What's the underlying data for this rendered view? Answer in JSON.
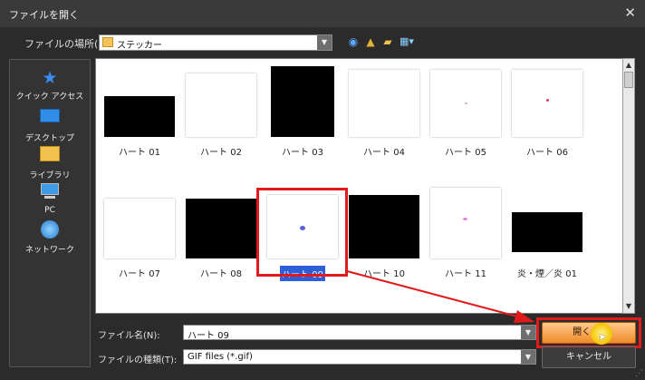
{
  "dialog": {
    "title": "ファイルを開く",
    "close_icon": "✕"
  },
  "lookin": {
    "label": "ファイルの場所(I):",
    "value": "ステッカー"
  },
  "places": [
    {
      "name": "クイック アクセス",
      "icon": "star-icon"
    },
    {
      "name": "デスクトップ",
      "icon": "desktop-icon"
    },
    {
      "name": "ライブラリ",
      "icon": "library-icon"
    },
    {
      "name": "PC",
      "icon": "computer-icon"
    },
    {
      "name": "ネットワーク",
      "icon": "network-icon"
    }
  ],
  "files": [
    {
      "name": "ハート 01",
      "thumb": "black-wide"
    },
    {
      "name": "ハート 02",
      "thumb": "white"
    },
    {
      "name": "ハート 03",
      "thumb": "black-tall"
    },
    {
      "name": "ハート 04",
      "thumb": "white"
    },
    {
      "name": "ハート 05",
      "thumb": "white-dot-pink"
    },
    {
      "name": "ハート 06",
      "thumb": "white-dot-red"
    },
    {
      "name": "ハート 07",
      "thumb": "white"
    },
    {
      "name": "ハート 08",
      "thumb": "black-wide"
    },
    {
      "name": "ハート 09",
      "thumb": "white-dot-blue",
      "selected": true
    },
    {
      "name": "ハート 10",
      "thumb": "black-wide"
    },
    {
      "name": "ハート 11",
      "thumb": "white-dot-magenta"
    },
    {
      "name": "炎・煙／炎 01",
      "thumb": "black-wide"
    }
  ],
  "filename": {
    "label": "ファイル名(N):",
    "value": "ハート 09"
  },
  "filetype": {
    "label": "ファイルの種類(T):",
    "value": "GIF files (*.gif)"
  },
  "buttons": {
    "open": "開く(O)",
    "cancel": "キャンセル"
  },
  "colors": {
    "highlight": "#e11b1b",
    "selection": "#2f5fd8",
    "open_button": "#f08a2a"
  }
}
